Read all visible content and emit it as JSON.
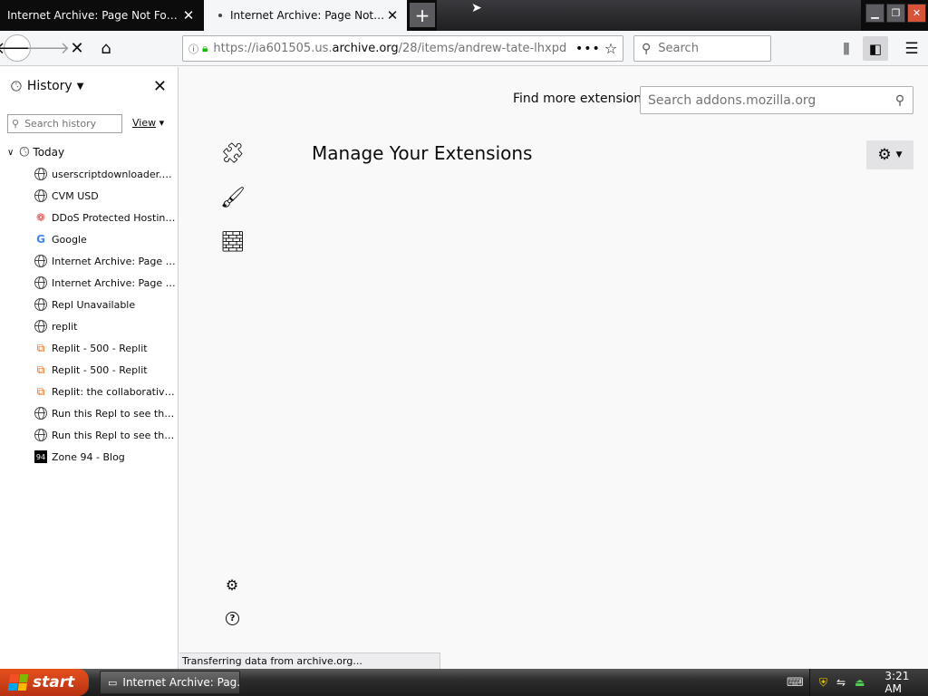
{
  "tabs": [
    {
      "title": "Internet Archive: Page Not Found",
      "active": false
    },
    {
      "title": "Internet Archive: Page Not Found",
      "active": true
    }
  ],
  "toolbar": {
    "url_prefix": "https://ia601505.us.",
    "url_domain": "archive.org",
    "url_path": "/28/items/andrew-tate-lhxpd",
    "search_placeholder": "Search",
    "page_actions": "•••"
  },
  "sidebar": {
    "title": "History",
    "search_placeholder": "Search history",
    "view_label": "View",
    "group_label": "Today",
    "items": [
      {
        "label": "userscriptdownloader.pur...",
        "icon": "globe-icon"
      },
      {
        "label": "CVM USD",
        "icon": "globe-icon"
      },
      {
        "label": "DDoS Protected Hosting S...",
        "icon": "ddos-favicon"
      },
      {
        "label": "Google",
        "icon": "google-favicon"
      },
      {
        "label": "Internet Archive: Page No...",
        "icon": "globe-icon"
      },
      {
        "label": "Internet Archive: Page No...",
        "icon": "globe-icon"
      },
      {
        "label": "Repl Unavailable",
        "icon": "globe-icon"
      },
      {
        "label": "replit",
        "icon": "globe-icon"
      },
      {
        "label": "Replit - 500 - Replit",
        "icon": "replit-favicon"
      },
      {
        "label": "Replit - 500 - Replit",
        "icon": "replit-favicon"
      },
      {
        "label": "Replit: the collaborative br...",
        "icon": "replit-favicon"
      },
      {
        "label": "Run this Repl to see the r...",
        "icon": "globe-icon"
      },
      {
        "label": "Run this Repl to see the r...",
        "icon": "globe-icon"
      },
      {
        "label": "Zone 94 - Blog",
        "icon": "zone-favicon"
      }
    ]
  },
  "main": {
    "find_more_label": "Find more extensions",
    "addon_search_placeholder": "Search addons.mozilla.org",
    "page_title": "Manage Your Extensions",
    "categories": [
      {
        "name": "extensions",
        "icon": "puzzle-icon"
      },
      {
        "name": "themes",
        "icon": "brush-icon"
      },
      {
        "name": "plugins",
        "icon": "plugin-icon"
      }
    ]
  },
  "status": {
    "text": "Transferring data from archive.org..."
  },
  "taskbar": {
    "start_label": "start",
    "task_label": "Internet Archive: Pag...",
    "clock": "3:21 AM"
  },
  "colors": {
    "tabbar_bg": "#0c0c0d",
    "lock_green": "#12bc00",
    "start_orange": "#d9461a",
    "close_red": "#d7533a"
  }
}
